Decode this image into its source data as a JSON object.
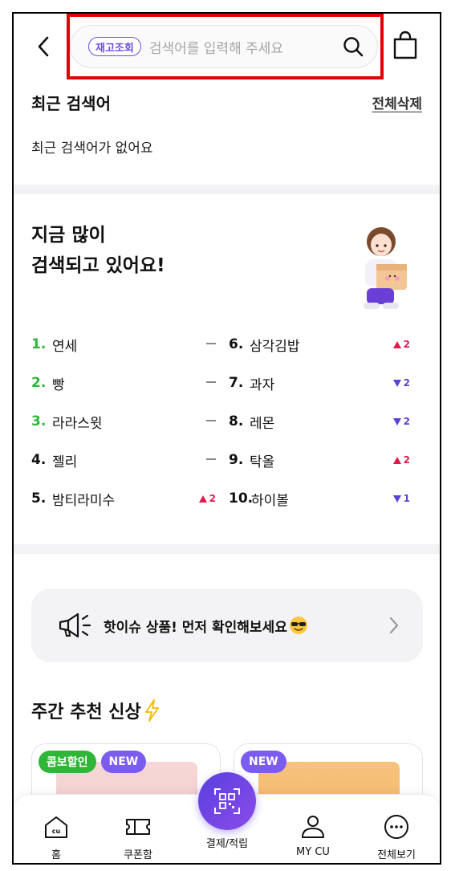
{
  "header": {
    "back_icon": "chevron-left-icon",
    "search_chip": "재고조회",
    "search_placeholder": "검색어를 입력해 주세요",
    "search_icon": "search-icon",
    "bag_icon": "shopping-bag-icon",
    "highlight_color": "#e30000"
  },
  "recent": {
    "title": "최근 검색어",
    "delete_all": "전체삭제",
    "empty_message": "최근 검색어가 없어요"
  },
  "popular": {
    "title": "지금 많이\n검색되고 있어요!",
    "left": [
      {
        "rank": "1.",
        "word": "연세",
        "change": "same",
        "amount": ""
      },
      {
        "rank": "2.",
        "word": "빵",
        "change": "same",
        "amount": ""
      },
      {
        "rank": "3.",
        "word": "라라스윗",
        "change": "same",
        "amount": ""
      },
      {
        "rank": "4.",
        "word": "젤리",
        "change": "same",
        "amount": ""
      },
      {
        "rank": "5.",
        "word": "밤티라미수",
        "change": "up",
        "amount": "2"
      }
    ],
    "right": [
      {
        "rank": "6.",
        "word": "삼각김밥",
        "change": "up",
        "amount": "2"
      },
      {
        "rank": "7.",
        "word": "과자",
        "change": "down",
        "amount": "2"
      },
      {
        "rank": "8.",
        "word": "레몬",
        "change": "down",
        "amount": "2"
      },
      {
        "rank": "9.",
        "word": "탁올",
        "change": "up",
        "amount": "2"
      },
      {
        "rank": "10.",
        "word": "하이볼",
        "change": "down",
        "amount": "1"
      }
    ],
    "top_rank_color": "#2fb638",
    "up_color": "#e01b4c",
    "down_color": "#5a42d8"
  },
  "hot_issue": {
    "text": "핫이슈 상품! 먼저 확인해보세요",
    "icon": "megaphone-icon",
    "emoji": "sunglasses-emoji-icon"
  },
  "weekly": {
    "title": "주간 추천 신상",
    "cards": [
      {
        "badges": [
          "콤보할인",
          "NEW"
        ]
      },
      {
        "badges": [
          "NEW"
        ]
      }
    ]
  },
  "nav": {
    "items": [
      {
        "label": "홈",
        "icon": "home-cu-icon"
      },
      {
        "label": "쿠폰함",
        "icon": "coupon-icon"
      },
      {
        "label": "결제/적립",
        "icon": "qr-code-icon"
      },
      {
        "label": "MY CU",
        "icon": "person-icon"
      },
      {
        "label": "전체보기",
        "icon": "more-icon"
      }
    ],
    "accent": "#6b4de6"
  }
}
